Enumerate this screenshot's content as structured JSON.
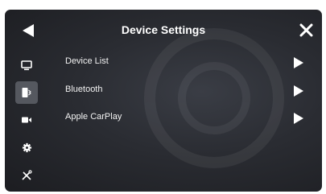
{
  "header": {
    "title": "Device Settings",
    "back_icon": "back-arrow-icon",
    "close_icon": "close-icon"
  },
  "sidebar": {
    "items": [
      {
        "name": "display",
        "icon": "monitor-icon",
        "active": false
      },
      {
        "name": "device",
        "icon": "phone-bluetooth-icon",
        "active": true
      },
      {
        "name": "camera",
        "icon": "camera-icon",
        "active": false
      },
      {
        "name": "settings",
        "icon": "gear-icon",
        "active": false
      },
      {
        "name": "tools",
        "icon": "tools-icon",
        "active": false
      }
    ]
  },
  "menu": {
    "items": [
      {
        "label": "Device List",
        "icon": "chevron-right-icon"
      },
      {
        "label": "Bluetooth",
        "icon": "chevron-right-icon"
      },
      {
        "label": "Apple CarPlay",
        "icon": "chevron-right-icon"
      }
    ]
  },
  "colors": {
    "background_center": "#3a3d45",
    "background_edge": "#1c1d21",
    "active_item": "#55585f",
    "text": "#ffffff"
  }
}
